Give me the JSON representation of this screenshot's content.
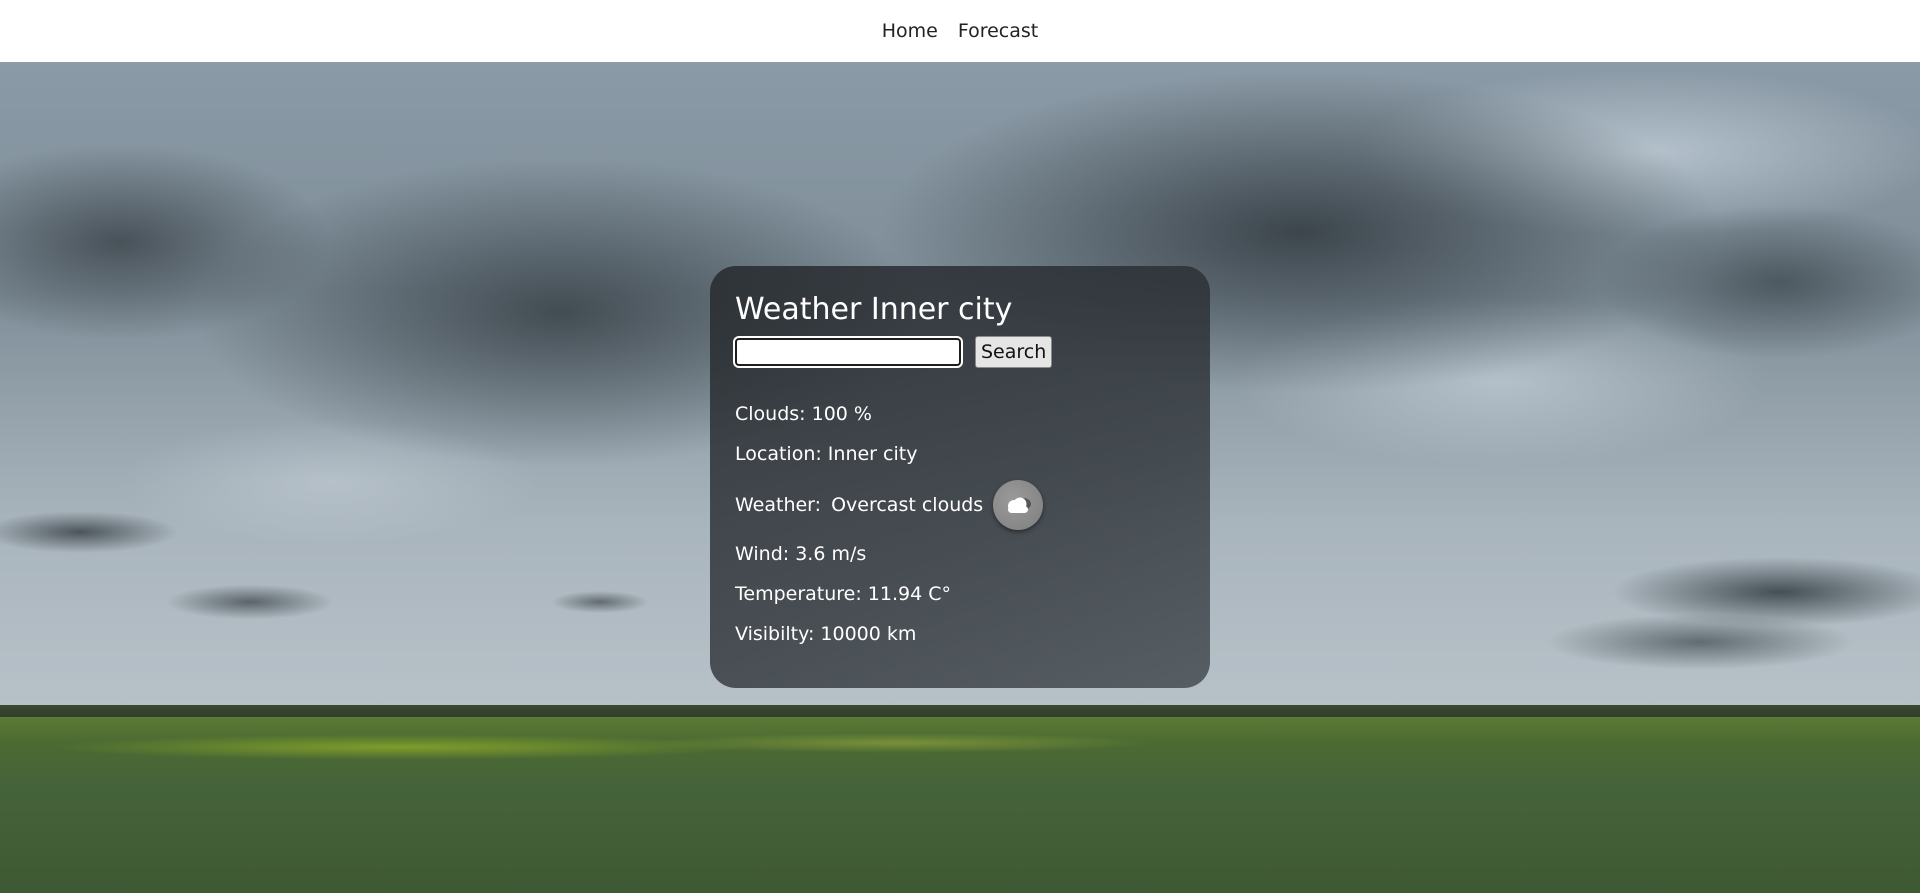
{
  "nav": {
    "home_label": "Home",
    "forecast_label": "Forecast"
  },
  "card": {
    "title": "Weather Inner city",
    "search_input_value": "",
    "search_button_label": "Search",
    "clouds": "Clouds: 100 %",
    "location": "Location: Inner city",
    "weather_label": "Weather:",
    "weather_description": "Overcast clouds",
    "weather_icon": "overcast-cloud-icon",
    "wind": "Wind: 3.6 m/s",
    "temperature": "Temperature: 11.94 C°",
    "visibility": "Visibilty: 10000 km"
  }
}
